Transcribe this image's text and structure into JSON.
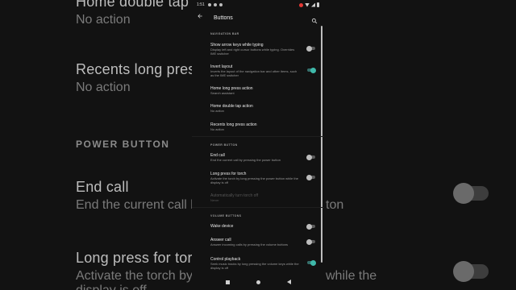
{
  "background": {
    "items": [
      {
        "title": "Home double tap t",
        "sub": "No action"
      },
      {
        "title": "Recents long press",
        "sub": "No action"
      },
      {
        "header": "POWER BUTTON"
      },
      {
        "title": "End call",
        "sub": "End the current call b"
      },
      {
        "title": "Long press for torc",
        "sub": "Activate the torch by"
      },
      {
        "sub2": "display is off"
      }
    ],
    "right_snippets": [
      "ton",
      "while the"
    ]
  },
  "status": {
    "time": "1:51"
  },
  "appbar": {
    "title": "Buttons",
    "back_icon": "arrow-left-icon",
    "search_icon": "search-icon"
  },
  "sections": {
    "nav_bar": "NAVIGATION BAR",
    "power": "POWER BUTTON",
    "volume": "VOLUME BUTTONS"
  },
  "prefs": {
    "show_arrow": {
      "title": "Show arrow keys while typing",
      "sub": "Display left and right cursor buttons while typing. Overrides IME switcher",
      "on": false
    },
    "invert": {
      "title": "Invert layout",
      "sub": "Inverts the layout of the navigation bar and other items, such as the IME switcher",
      "on": true
    },
    "home_long": {
      "title": "Home long press action",
      "sub": "Search assistant"
    },
    "home_double": {
      "title": "Home double tap action",
      "sub": "No action"
    },
    "recents_long": {
      "title": "Recents long press action",
      "sub": "No action"
    },
    "end_call": {
      "title": "End call",
      "sub": "End the current call by pressing the power button",
      "on": false
    },
    "torch": {
      "title": "Long press for torch",
      "sub": "Activate the torch by long pressing the power button while the display is off",
      "on": false
    },
    "torch_off": {
      "title": "Automatically turn torch off",
      "sub": "Never"
    },
    "wake": {
      "title": "Wake device",
      "on": false
    },
    "answer": {
      "title": "Answer call",
      "sub": "Answer incoming calls by pressing the volume buttons",
      "on": false
    },
    "playback": {
      "title": "Control playback",
      "sub": "Seek music tracks by long pressing the volume keys while the display is off",
      "on": true
    }
  },
  "colors": {
    "accent": "#3fb9aa",
    "background": "#121212"
  }
}
